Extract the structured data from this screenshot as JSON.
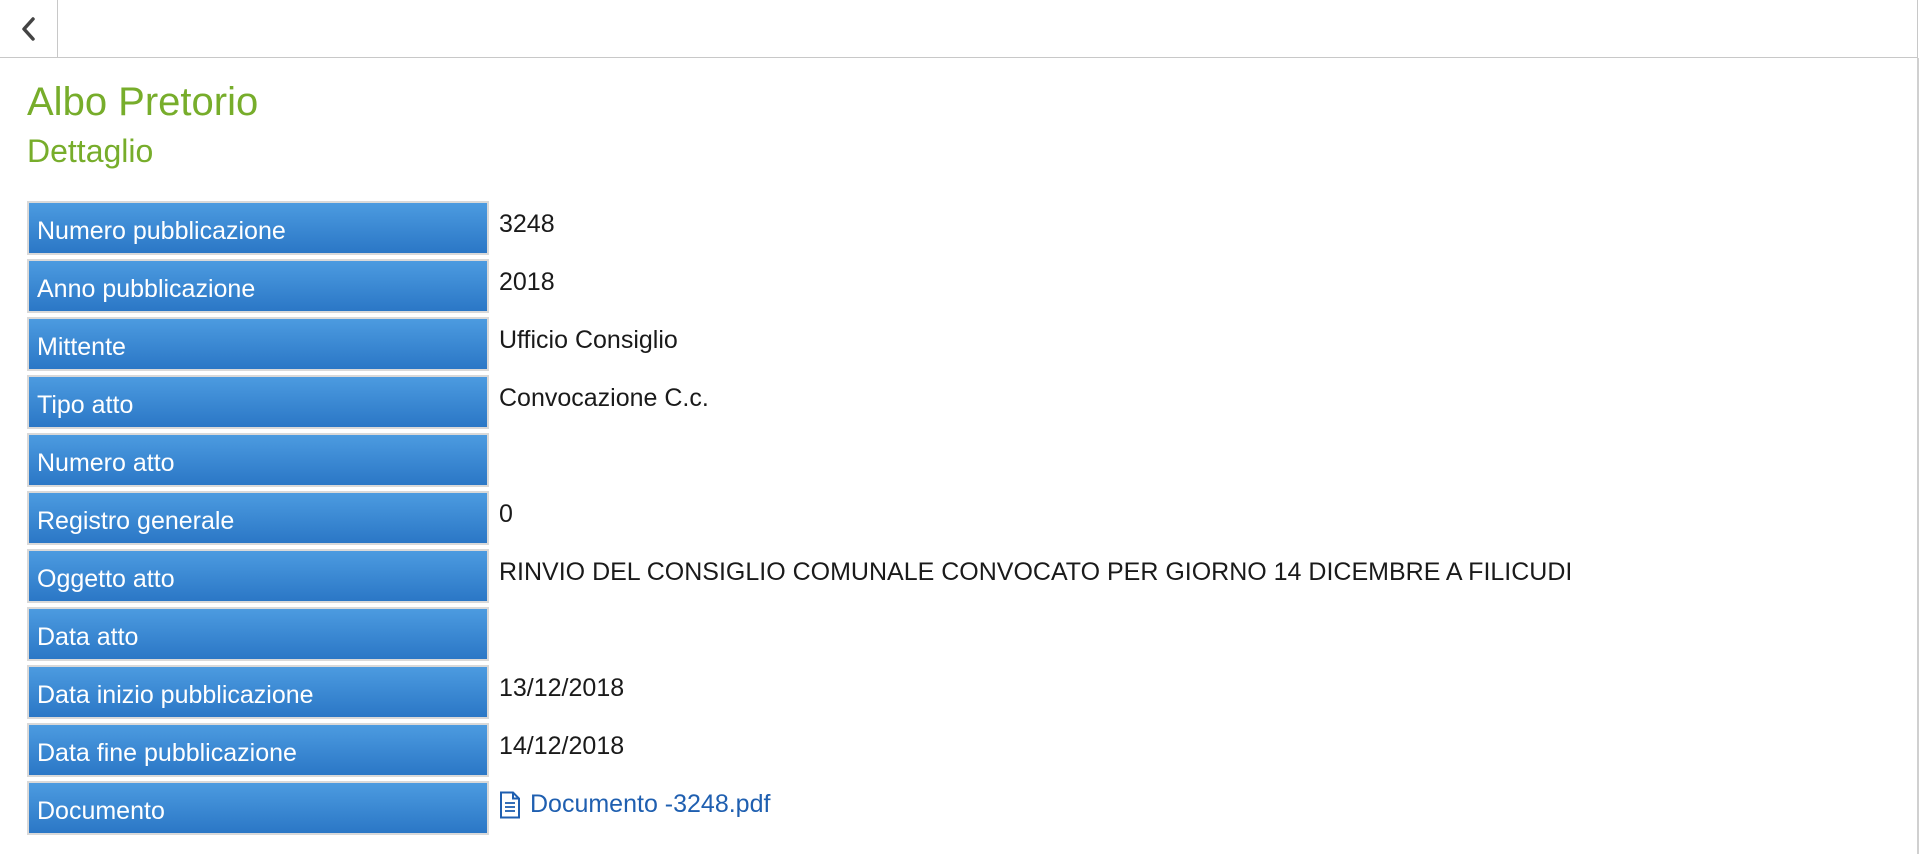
{
  "header": {
    "back_icon": "chevron-left-icon"
  },
  "page": {
    "title": "Albo Pretorio",
    "subtitle": "Dettaglio"
  },
  "details": {
    "numero_pubblicazione": {
      "label": "Numero pubblicazione",
      "value": "3248"
    },
    "anno_pubblicazione": {
      "label": "Anno pubblicazione",
      "value": "2018"
    },
    "mittente": {
      "label": "Mittente",
      "value": "Ufficio Consiglio"
    },
    "tipo_atto": {
      "label": "Tipo atto",
      "value": "Convocazione C.c."
    },
    "numero_atto": {
      "label": "Numero atto",
      "value": ""
    },
    "registro_generale": {
      "label": "Registro generale",
      "value": "0"
    },
    "oggetto_atto": {
      "label": "Oggetto atto",
      "value": "RINVIO DEL CONSIGLIO COMUNALE CONVOCATO PER GIORNO 14 DICEMBRE A FILICUDI"
    },
    "data_atto": {
      "label": "Data atto",
      "value": ""
    },
    "data_inizio_pubblicazione": {
      "label": "Data inizio pubblicazione",
      "value": "13/12/2018"
    },
    "data_fine_pubblicazione": {
      "label": "Data fine pubblicazione",
      "value": "14/12/2018"
    },
    "documento": {
      "label": "Documento",
      "value": "Documento -3248.pdf",
      "icon": "document-icon"
    }
  },
  "colors": {
    "title_green": "#77ad2b",
    "label_blue": "#3385d2",
    "link_blue": "#1f5fb0"
  }
}
